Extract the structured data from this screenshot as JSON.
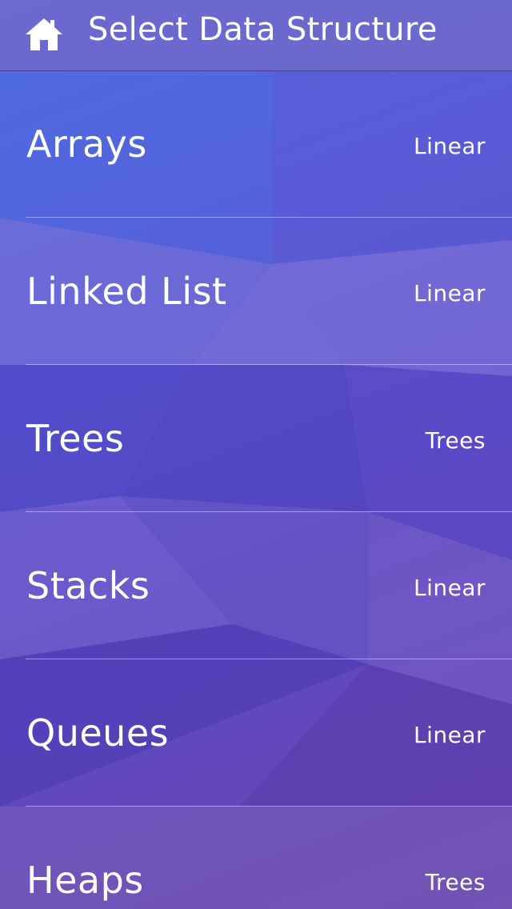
{
  "nav": {
    "title": "Select Data Structure",
    "home_icon": "home-icon"
  },
  "colors": {
    "nav_background": "#6e69cd",
    "text": "#ffffff",
    "gradient_top": "#4f6fe0",
    "gradient_bottom": "#6a45b0"
  },
  "list": {
    "items": [
      {
        "label": "Arrays",
        "detail": "Linear"
      },
      {
        "label": "Linked List",
        "detail": "Linear"
      },
      {
        "label": "Trees",
        "detail": "Trees"
      },
      {
        "label": "Stacks",
        "detail": "Linear"
      },
      {
        "label": "Queues",
        "detail": "Linear"
      },
      {
        "label": "Heaps",
        "detail": "Trees"
      }
    ]
  }
}
